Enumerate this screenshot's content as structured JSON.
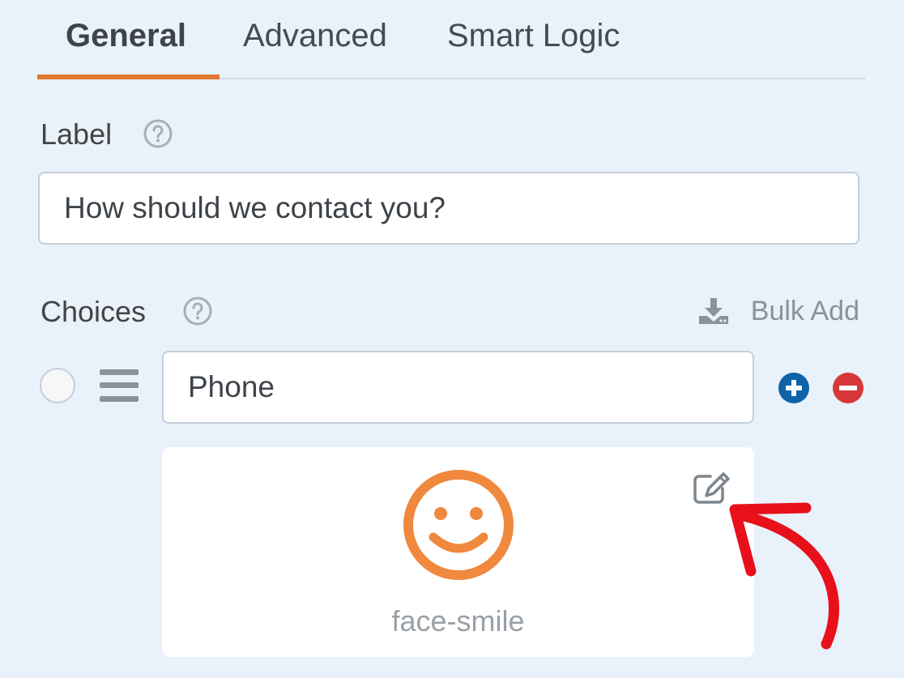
{
  "tabs": [
    {
      "label": "General",
      "active": true
    },
    {
      "label": "Advanced",
      "active": false
    },
    {
      "label": "Smart Logic",
      "active": false
    }
  ],
  "label_field": {
    "label": "Label",
    "value": "How should we contact you?"
  },
  "choices": {
    "label": "Choices",
    "bulk_add": "Bulk Add",
    "items": [
      {
        "value": "Phone",
        "icon": "face-smile",
        "selected": false
      }
    ]
  },
  "icons": {
    "help": "question-circle-icon",
    "bulk_add": "download-icon",
    "drag": "bars-icon",
    "add": "plus-circle-icon",
    "remove": "minus-circle-icon",
    "edit": "pen-to-square-icon"
  },
  "colors": {
    "accent": "#e27730",
    "add": "#0e63a8",
    "remove": "#d63638",
    "annotation": "#e8101b"
  }
}
